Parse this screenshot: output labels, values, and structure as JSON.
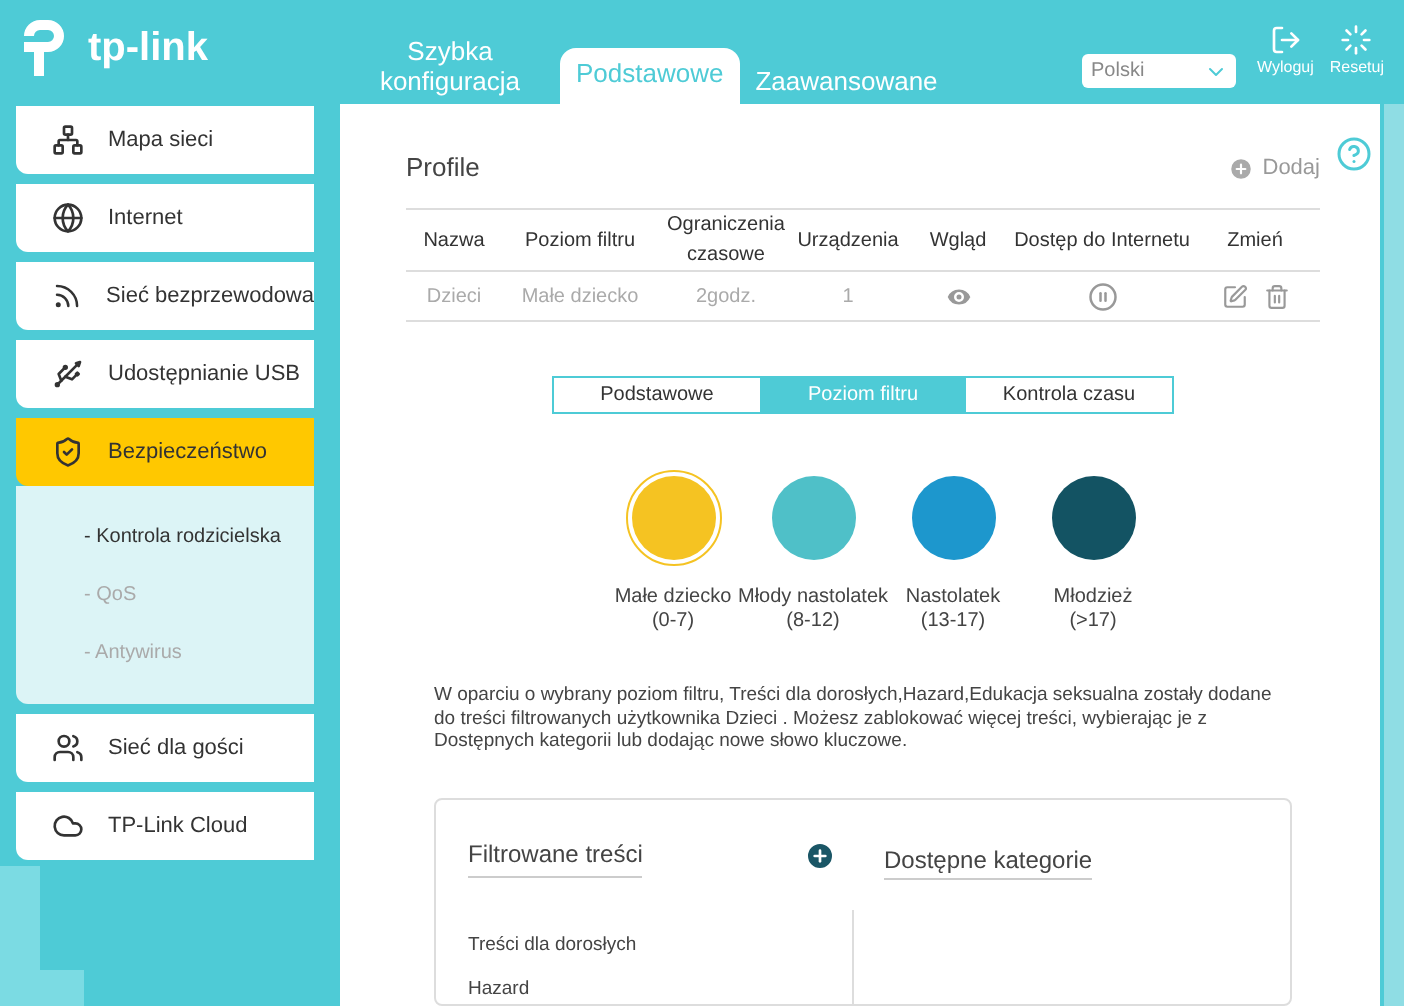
{
  "header": {
    "brand": "tp-link",
    "nav_tabs": [
      {
        "label": "Szybka konfiguracja",
        "selected": false
      },
      {
        "label": "Podstawowe",
        "selected": true
      },
      {
        "label": "Zaawansowane",
        "selected": false
      }
    ],
    "language": "Polski",
    "actions": [
      {
        "kind": "logout",
        "label": "Wyloguj"
      },
      {
        "kind": "reset",
        "label": "Resetuj"
      }
    ]
  },
  "sidebar": {
    "items": [
      {
        "kind": "network",
        "label": "Mapa sieci",
        "selected": false
      },
      {
        "kind": "globe",
        "label": "Internet",
        "selected": false
      },
      {
        "kind": "wireless",
        "label": "Sieć bezprzewodowa",
        "selected": false
      },
      {
        "kind": "usb",
        "label": "Udostępnianie USB",
        "selected": false
      },
      {
        "kind": "shield",
        "label": "Bezpieczeństwo",
        "selected": true,
        "expanded": true,
        "children": [
          {
            "label": "- Kontrola rodzicielska",
            "selected": true
          },
          {
            "label": "- QoS",
            "selected": false
          },
          {
            "label": "- Antywirus",
            "selected": false
          }
        ]
      },
      {
        "kind": "users",
        "label": "Sieć dla gości",
        "selected": false
      },
      {
        "kind": "cloud",
        "label": "TP-Link Cloud",
        "selected": false
      }
    ]
  },
  "profile": {
    "title": "Profile",
    "add_label": "Dodaj",
    "table": {
      "columns": [
        "Nazwa",
        "Poziom filtru",
        "Ograniczenia czasowe",
        "Urządzenia",
        "Wgląd",
        "Dostęp do Internetu",
        "Zmień"
      ],
      "rows": [
        {
          "name": "Dzieci",
          "filter_level": "Małe dziecko",
          "time_limit": "2godz.",
          "devices": "1"
        }
      ]
    }
  },
  "sub_tabs": [
    {
      "label": "Podstawowe",
      "selected": false
    },
    {
      "label": "Poziom filtru",
      "selected": true
    },
    {
      "label": "Kontrola czasu",
      "selected": false
    }
  ],
  "filter_levels": [
    {
      "label": "Małe dziecko",
      "range": "(0-7)",
      "color": "#f5c322",
      "selected": true
    },
    {
      "label": "Młody nastolatek",
      "range": "(8-12)",
      "color": "#4fc0c8",
      "selected": false
    },
    {
      "label": "Nastolatek",
      "range": "(13-17)",
      "color": "#1d97cd",
      "selected": false
    },
    {
      "label": "Młodzież",
      "range": "(>17)",
      "color": "#135363",
      "selected": false
    }
  ],
  "description": "W oparciu o wybrany poziom filtru, Treści dla dorosłych,Hazard,Edukacja seksualna zostały dodane do treści filtrowanych użytkownika Dzieci . Możesz zablokować więcej treści, wybierając je z Dostępnych kategorii lub dodając nowe słowo kluczowe.",
  "filtered_content": {
    "title": "Filtrowane treści",
    "items": [
      "Treści dla dorosłych",
      "Hazard"
    ]
  },
  "available_categories": {
    "title": "Dostępne kategorie"
  }
}
